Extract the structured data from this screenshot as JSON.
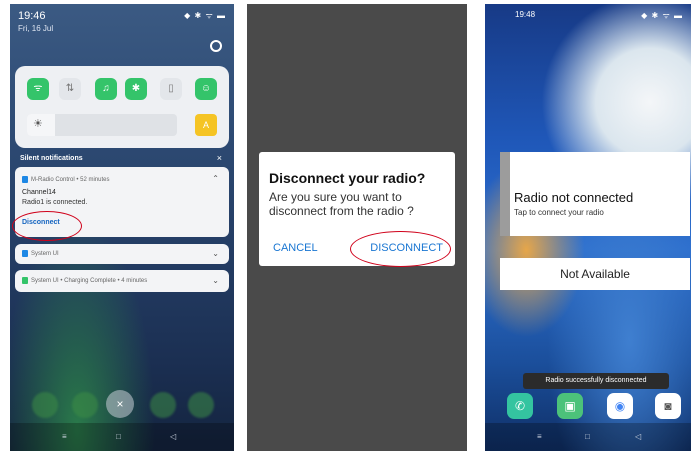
{
  "phone1": {
    "status_time": "19:46",
    "status_icons": "◆ ✱ ᯤ ▬",
    "date": "Fri, 16 Jul",
    "quick_tiles": [
      {
        "icon": "wifi-icon",
        "glyph": "ᯤ",
        "on": true
      },
      {
        "icon": "data-icon",
        "glyph": "⇅",
        "on": false
      },
      {
        "icon": "headset-icon",
        "glyph": "♫",
        "on": true
      },
      {
        "icon": "bluetooth-icon",
        "glyph": "✱",
        "on": true
      },
      {
        "icon": "flashlight-icon",
        "glyph": "▯",
        "on": false
      },
      {
        "icon": "user-icon",
        "glyph": "☺",
        "on": true
      }
    ],
    "brightness_auto_label": "A",
    "silent_label": "Silent notifications",
    "close_glyph": "×",
    "notifications": [
      {
        "app": "M-Radio Control • 52 minutes",
        "title": "Channel14",
        "body": "Radio1 is connected.",
        "action": "Disconnect"
      },
      {
        "app": "System UI"
      },
      {
        "app": "System UI • Charging Complete • 4 minutes"
      }
    ],
    "dismiss_glyph": "×",
    "nav": {
      "menu": "≡",
      "home": "□",
      "back": "◁"
    }
  },
  "phone2": {
    "dialog_title": "Disconnect your radio?",
    "dialog_message": "Are you sure you want to disconnect from the radio ?",
    "cancel_label": "CANCEL",
    "disconnect_label": "DISCONNECT"
  },
  "phone3": {
    "status_time": "19:48",
    "status_icons": "◆ ✱ ᯤ ▬",
    "widget_title": "Radio not connected",
    "widget_subtitle": "Tap to connect your radio",
    "not_available": "Not Available",
    "toast": "Radio successfully disconnected",
    "dock_apps": [
      {
        "name": "phone-app-icon",
        "glyph": "✆",
        "bg": "#34c4a0"
      },
      {
        "name": "files-app-icon",
        "glyph": "▣",
        "bg": "#4cc27a"
      },
      {
        "name": "chrome-app-icon",
        "glyph": "◉",
        "bg": "#ffffff"
      },
      {
        "name": "camera-app-icon",
        "glyph": "◙",
        "bg": "#ffffff"
      }
    ],
    "nav": {
      "menu": "≡",
      "home": "□",
      "back": "◁"
    }
  },
  "colors": {
    "accent_green": "#34c46a",
    "link_blue": "#1976d2",
    "highlight_red": "#d0021b"
  }
}
